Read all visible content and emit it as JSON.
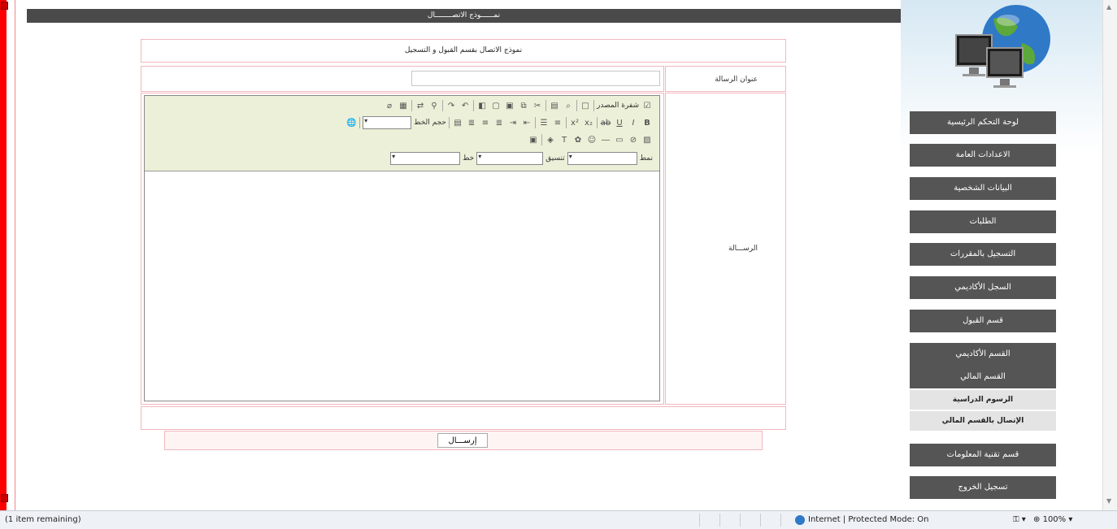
{
  "page": {
    "title": "نمــــــوذج الاتصــــــــال",
    "form_header": "نموذج الاتصال بقسم القبول و التسجيل",
    "subject_label": "عنوان الرسالة",
    "subject_value": "",
    "message_label": "الرســـالة",
    "send_label": "إرســـال"
  },
  "editor": {
    "source_label": "شفرة المصدر",
    "font_size_label": "حجم الخط",
    "style_label": "نمط",
    "format_label": "تنسيق",
    "font_label": "خط"
  },
  "nav": {
    "items": [
      "لوحة التحكم الرئيسية",
      "الاعدادات العامة",
      "البيانات الشخصية",
      "الطلبات",
      "التسجيل بالمقررات",
      "السجل الأكاديمي",
      "قسم القبول",
      "القسم الأكاديمي",
      "القسم المالي",
      "قسم تقنية المعلومات",
      "تسجيل الخروج"
    ],
    "sub_items": [
      "الرسوم الدراسية",
      "الإتصال بالقسم المالي"
    ]
  },
  "status_bar": {
    "left_text": "(1 item remaining)",
    "zone_text": "Internet | Protected Mode: On",
    "zoom": "100%"
  },
  "colors": {
    "accent_red": "#ff0000",
    "nav_button": "#555555",
    "title_bar": "#4a4a4a",
    "frame_border": "#f1b7bd",
    "toolbar_bg": "#edf0d8"
  }
}
